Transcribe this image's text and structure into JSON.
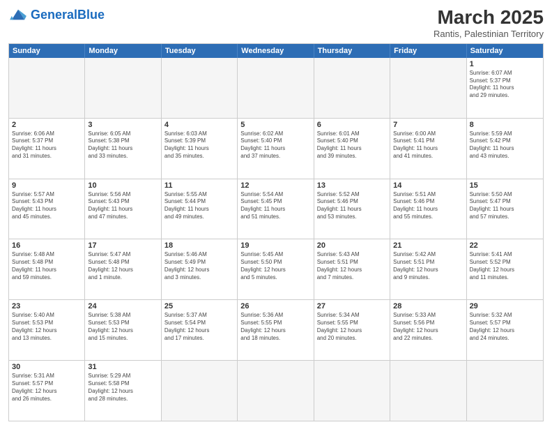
{
  "header": {
    "logo_general": "General",
    "logo_blue": "Blue",
    "month_title": "March 2025",
    "subtitle": "Rantis, Palestinian Territory"
  },
  "days_of_week": [
    "Sunday",
    "Monday",
    "Tuesday",
    "Wednesday",
    "Thursday",
    "Friday",
    "Saturday"
  ],
  "weeks": [
    [
      {
        "day": "",
        "info": "",
        "empty": true
      },
      {
        "day": "",
        "info": "",
        "empty": true
      },
      {
        "day": "",
        "info": "",
        "empty": true
      },
      {
        "day": "",
        "info": "",
        "empty": true
      },
      {
        "day": "",
        "info": "",
        "empty": true
      },
      {
        "day": "",
        "info": "",
        "empty": true
      },
      {
        "day": "1",
        "info": "Sunrise: 6:07 AM\nSunset: 5:37 PM\nDaylight: 11 hours\nand 29 minutes."
      }
    ],
    [
      {
        "day": "2",
        "info": "Sunrise: 6:06 AM\nSunset: 5:37 PM\nDaylight: 11 hours\nand 31 minutes."
      },
      {
        "day": "3",
        "info": "Sunrise: 6:05 AM\nSunset: 5:38 PM\nDaylight: 11 hours\nand 33 minutes."
      },
      {
        "day": "4",
        "info": "Sunrise: 6:03 AM\nSunset: 5:39 PM\nDaylight: 11 hours\nand 35 minutes."
      },
      {
        "day": "5",
        "info": "Sunrise: 6:02 AM\nSunset: 5:40 PM\nDaylight: 11 hours\nand 37 minutes."
      },
      {
        "day": "6",
        "info": "Sunrise: 6:01 AM\nSunset: 5:40 PM\nDaylight: 11 hours\nand 39 minutes."
      },
      {
        "day": "7",
        "info": "Sunrise: 6:00 AM\nSunset: 5:41 PM\nDaylight: 11 hours\nand 41 minutes."
      },
      {
        "day": "8",
        "info": "Sunrise: 5:59 AM\nSunset: 5:42 PM\nDaylight: 11 hours\nand 43 minutes."
      }
    ],
    [
      {
        "day": "9",
        "info": "Sunrise: 5:57 AM\nSunset: 5:43 PM\nDaylight: 11 hours\nand 45 minutes."
      },
      {
        "day": "10",
        "info": "Sunrise: 5:56 AM\nSunset: 5:43 PM\nDaylight: 11 hours\nand 47 minutes."
      },
      {
        "day": "11",
        "info": "Sunrise: 5:55 AM\nSunset: 5:44 PM\nDaylight: 11 hours\nand 49 minutes."
      },
      {
        "day": "12",
        "info": "Sunrise: 5:54 AM\nSunset: 5:45 PM\nDaylight: 11 hours\nand 51 minutes."
      },
      {
        "day": "13",
        "info": "Sunrise: 5:52 AM\nSunset: 5:46 PM\nDaylight: 11 hours\nand 53 minutes."
      },
      {
        "day": "14",
        "info": "Sunrise: 5:51 AM\nSunset: 5:46 PM\nDaylight: 11 hours\nand 55 minutes."
      },
      {
        "day": "15",
        "info": "Sunrise: 5:50 AM\nSunset: 5:47 PM\nDaylight: 11 hours\nand 57 minutes."
      }
    ],
    [
      {
        "day": "16",
        "info": "Sunrise: 5:48 AM\nSunset: 5:48 PM\nDaylight: 11 hours\nand 59 minutes."
      },
      {
        "day": "17",
        "info": "Sunrise: 5:47 AM\nSunset: 5:48 PM\nDaylight: 12 hours\nand 1 minute."
      },
      {
        "day": "18",
        "info": "Sunrise: 5:46 AM\nSunset: 5:49 PM\nDaylight: 12 hours\nand 3 minutes."
      },
      {
        "day": "19",
        "info": "Sunrise: 5:45 AM\nSunset: 5:50 PM\nDaylight: 12 hours\nand 5 minutes."
      },
      {
        "day": "20",
        "info": "Sunrise: 5:43 AM\nSunset: 5:51 PM\nDaylight: 12 hours\nand 7 minutes."
      },
      {
        "day": "21",
        "info": "Sunrise: 5:42 AM\nSunset: 5:51 PM\nDaylight: 12 hours\nand 9 minutes."
      },
      {
        "day": "22",
        "info": "Sunrise: 5:41 AM\nSunset: 5:52 PM\nDaylight: 12 hours\nand 11 minutes."
      }
    ],
    [
      {
        "day": "23",
        "info": "Sunrise: 5:40 AM\nSunset: 5:53 PM\nDaylight: 12 hours\nand 13 minutes."
      },
      {
        "day": "24",
        "info": "Sunrise: 5:38 AM\nSunset: 5:53 PM\nDaylight: 12 hours\nand 15 minutes."
      },
      {
        "day": "25",
        "info": "Sunrise: 5:37 AM\nSunset: 5:54 PM\nDaylight: 12 hours\nand 17 minutes."
      },
      {
        "day": "26",
        "info": "Sunrise: 5:36 AM\nSunset: 5:55 PM\nDaylight: 12 hours\nand 18 minutes."
      },
      {
        "day": "27",
        "info": "Sunrise: 5:34 AM\nSunset: 5:55 PM\nDaylight: 12 hours\nand 20 minutes."
      },
      {
        "day": "28",
        "info": "Sunrise: 5:33 AM\nSunset: 5:56 PM\nDaylight: 12 hours\nand 22 minutes."
      },
      {
        "day": "29",
        "info": "Sunrise: 5:32 AM\nSunset: 5:57 PM\nDaylight: 12 hours\nand 24 minutes."
      }
    ],
    [
      {
        "day": "30",
        "info": "Sunrise: 5:31 AM\nSunset: 5:57 PM\nDaylight: 12 hours\nand 26 minutes."
      },
      {
        "day": "31",
        "info": "Sunrise: 5:29 AM\nSunset: 5:58 PM\nDaylight: 12 hours\nand 28 minutes."
      },
      {
        "day": "",
        "info": "",
        "empty": true
      },
      {
        "day": "",
        "info": "",
        "empty": true
      },
      {
        "day": "",
        "info": "",
        "empty": true
      },
      {
        "day": "",
        "info": "",
        "empty": true
      },
      {
        "day": "",
        "info": "",
        "empty": true
      }
    ]
  ]
}
